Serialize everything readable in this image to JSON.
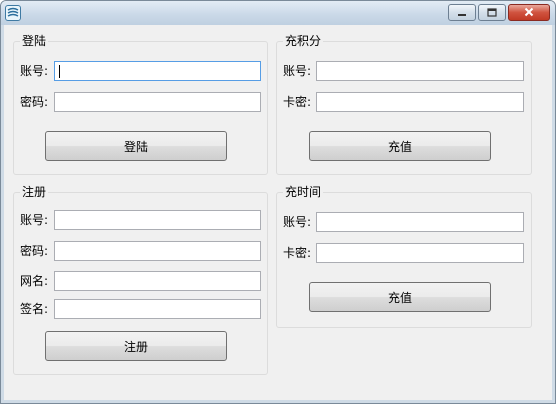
{
  "window": {
    "title": "",
    "icon": "app-icon",
    "controls": [
      "minimize-icon",
      "maximize-icon",
      "close-icon"
    ]
  },
  "login": {
    "title": "登陆",
    "account_label": "账号:",
    "account_value": "",
    "password_label": "密码:",
    "password_value": "",
    "button_label": "登陆"
  },
  "recharge_points": {
    "title": "充积分",
    "account_label": "账号:",
    "account_value": "",
    "card_label": "卡密:",
    "card_value": "",
    "button_label": "充值"
  },
  "register": {
    "title": "注册",
    "account_label": "账号:",
    "account_value": "",
    "password_label": "密码:",
    "password_value": "",
    "netname_label": "网名:",
    "netname_value": "",
    "signature_label": "签名:",
    "signature_value": "",
    "button_label": "注册"
  },
  "recharge_time": {
    "title": "充时间",
    "account_label": "账号:",
    "account_value": "",
    "card_label": "卡密:",
    "card_value": "",
    "button_label": "充值"
  },
  "colors": {
    "titlebar": "#c9d8e7",
    "client_bg": "#f0f0f0",
    "close_button": "#c13a25",
    "focus_border": "#569de5"
  }
}
